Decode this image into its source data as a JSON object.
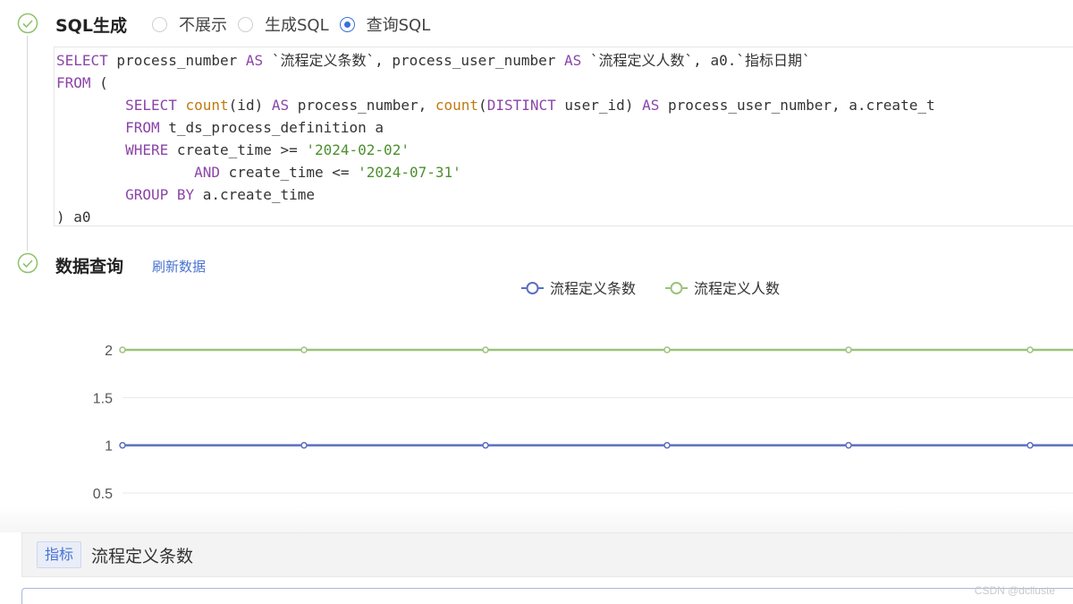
{
  "steps": {
    "sql": {
      "title": "SQL生成",
      "options": [
        "不展示",
        "生成SQL",
        "查询SQL"
      ],
      "selected": "查询SQL"
    },
    "query": {
      "title": "数据查询",
      "refresh_label": "刷新数据"
    }
  },
  "sql_lines": [
    [
      {
        "t": "SELECT",
        "c": "kw"
      },
      {
        "t": " process_number "
      },
      {
        "t": "AS",
        "c": "kw"
      },
      {
        "t": " `流程定义条数`, process_user_number "
      },
      {
        "t": "AS",
        "c": "kw"
      },
      {
        "t": " `流程定义人数`, a0.`指标日期`"
      }
    ],
    [
      {
        "t": "FROM",
        "c": "kw"
      },
      {
        "t": " ("
      }
    ],
    [
      {
        "t": "        "
      },
      {
        "t": "SELECT",
        "c": "kw"
      },
      {
        "t": " "
      },
      {
        "t": "count",
        "c": "fn"
      },
      {
        "t": "(id) "
      },
      {
        "t": "AS",
        "c": "kw"
      },
      {
        "t": " process_number, "
      },
      {
        "t": "count",
        "c": "fn"
      },
      {
        "t": "("
      },
      {
        "t": "DISTINCT",
        "c": "kw"
      },
      {
        "t": " user_id) "
      },
      {
        "t": "AS",
        "c": "kw"
      },
      {
        "t": " process_user_number, a.create_t"
      }
    ],
    [
      {
        "t": "        "
      },
      {
        "t": "FROM",
        "c": "kw"
      },
      {
        "t": " t_ds_process_definition a"
      }
    ],
    [
      {
        "t": "        "
      },
      {
        "t": "WHERE",
        "c": "kw"
      },
      {
        "t": " create_time >= "
      },
      {
        "t": "'2024-02-02'",
        "c": "str"
      }
    ],
    [
      {
        "t": "                "
      },
      {
        "t": "AND",
        "c": "kw"
      },
      {
        "t": " create_time <= "
      },
      {
        "t": "'2024-07-31'",
        "c": "str"
      }
    ],
    [
      {
        "t": "        "
      },
      {
        "t": "GROUP BY",
        "c": "kw"
      },
      {
        "t": " a.create_time"
      }
    ],
    [
      {
        "t": ") a0"
      }
    ]
  ],
  "chart_data": {
    "type": "line",
    "y_ticks": [
      "2",
      "1.5",
      "1",
      "0.5"
    ],
    "ylim": [
      0.5,
      2
    ],
    "point_count": 6,
    "series": [
      {
        "name": "流程定义条数",
        "color": "#5a6fc0",
        "values": [
          1,
          1,
          1,
          1,
          1,
          1
        ]
      },
      {
        "name": "流程定义人数",
        "color": "#9cc37a",
        "values": [
          2,
          2,
          2,
          2,
          2,
          2
        ]
      }
    ],
    "legend_position": "top-center",
    "grid": true
  },
  "metric": {
    "tag": "指标",
    "name": "流程定义条数"
  },
  "watermark": "CSDN @dclluste"
}
